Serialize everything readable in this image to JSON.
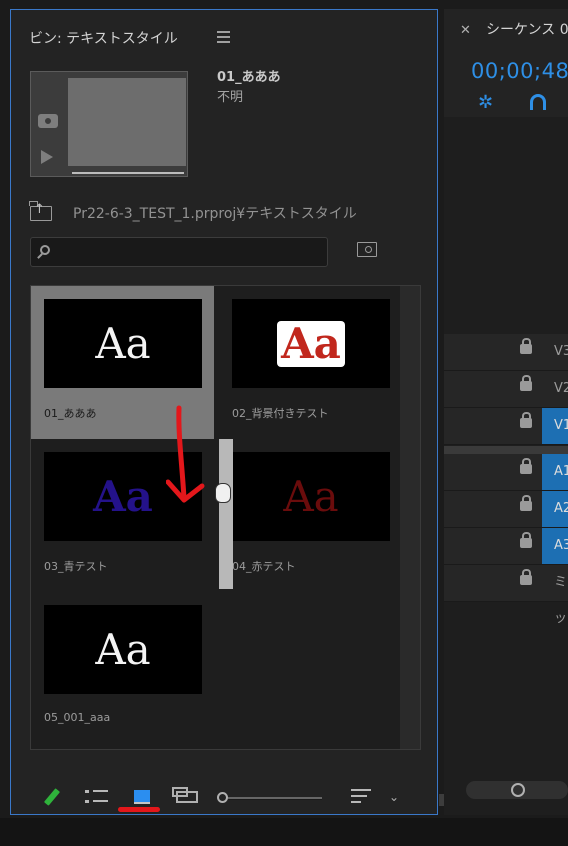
{
  "bin": {
    "title": "ビン: テキストスタイル",
    "preview": {
      "clip_name": "01_あああ",
      "status": "不明"
    },
    "path": "Pr22-6-3_TEST_1.prproj¥テキストスタイル",
    "search_placeholder": "",
    "items": [
      {
        "name": "01_あああ",
        "preview_text": "Aa",
        "selected": true
      },
      {
        "name": "02_背景付きテスト",
        "preview_text": "Aa",
        "selected": false
      },
      {
        "name": "03_青テスト",
        "preview_text": "Aa",
        "selected": false
      },
      {
        "name": "04_赤テスト",
        "preview_text": "Aa",
        "selected": false
      },
      {
        "name": "05_001_aaa",
        "preview_text": "Aa",
        "selected": false
      }
    ]
  },
  "sequence": {
    "title": "シーケンス 0",
    "timecode": "00;00;48;",
    "tracks": [
      "V3",
      "V2",
      "V1",
      "A1",
      "A2",
      "A3",
      "ミッ"
    ]
  },
  "colors": {
    "accent": "#2e8fe6",
    "panel_border": "#3a78c9",
    "annotation_red": "#e3171b"
  }
}
